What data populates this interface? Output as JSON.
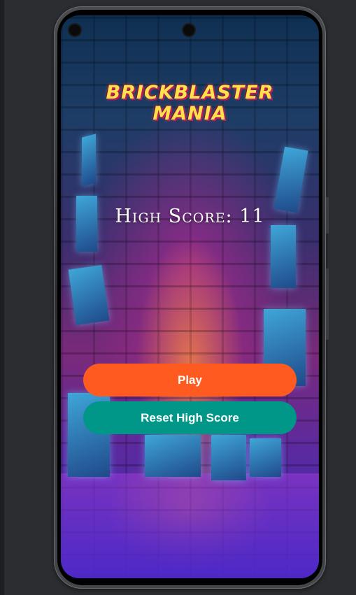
{
  "game": {
    "title_line1": "BRICKBLASTER",
    "title_line2": "MANIA",
    "high_score_text": "High Score: 11"
  },
  "buttons": {
    "play_label": "Play",
    "reset_label": "Reset High Score"
  },
  "colors": {
    "play_button": "#ff5a1f",
    "reset_button": "#009688",
    "title": "#ffe14a"
  }
}
